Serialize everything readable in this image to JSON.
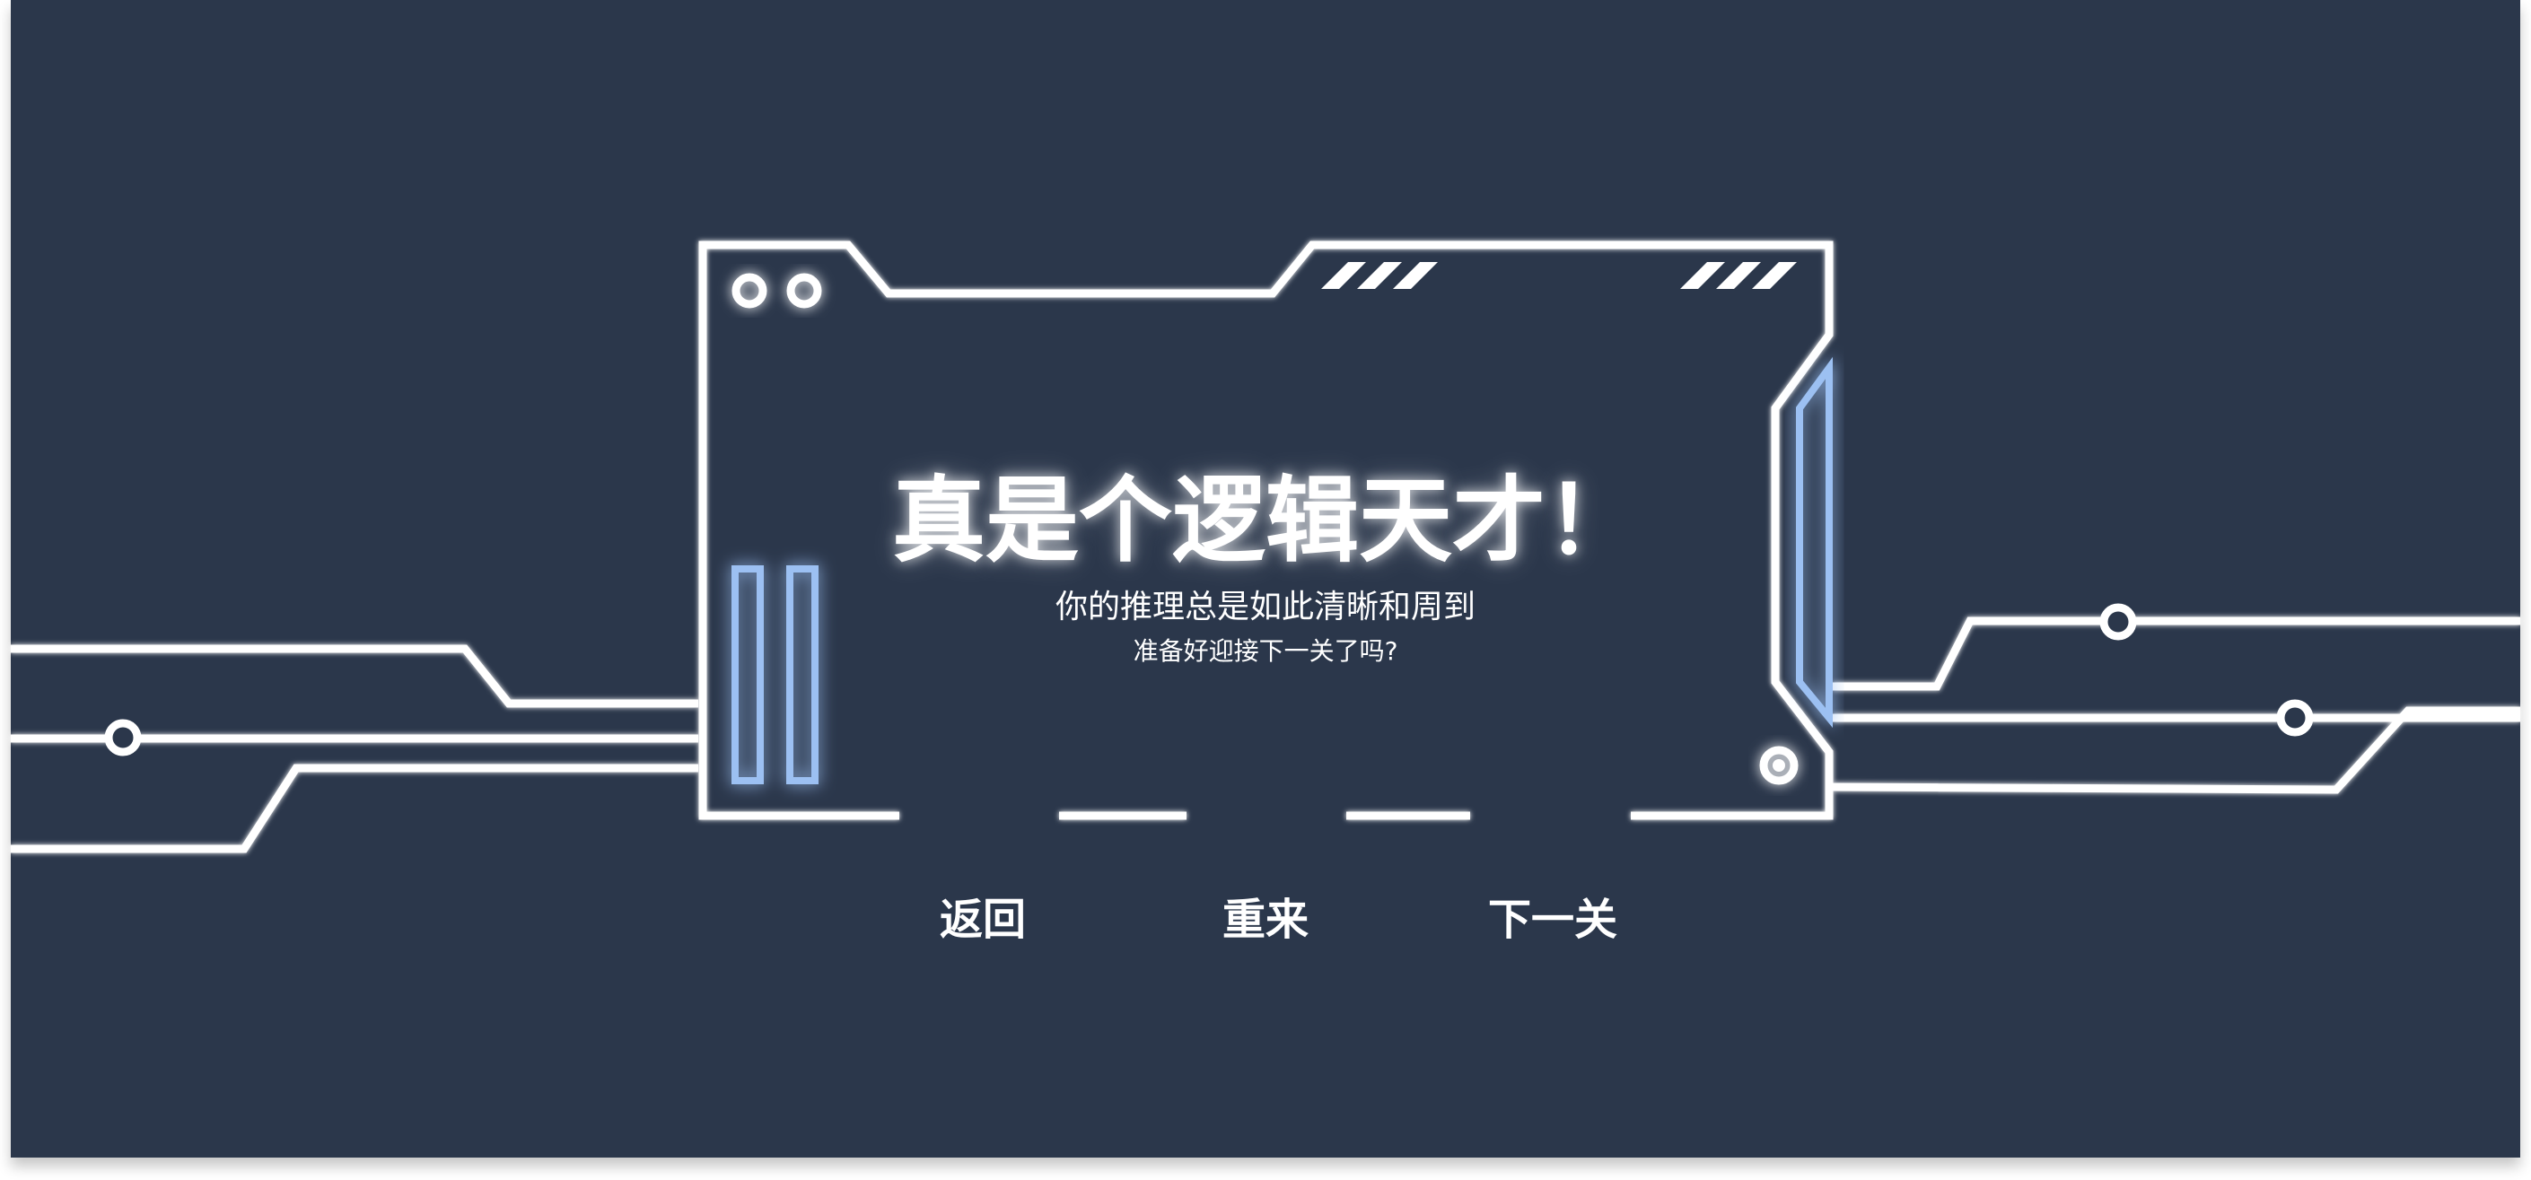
{
  "dialog": {
    "title": "真是个逻辑天才！",
    "message_line1": "你的推理总是如此清晰和周到",
    "message_line2": "准备好迎接下一关了吗?"
  },
  "buttons": {
    "back_label": "返回",
    "restart_label": "重来",
    "next_label": "下一关"
  },
  "colors": {
    "background": "#2b374b",
    "line": "#ffffff",
    "accent_glow": "#9cc0f2"
  }
}
